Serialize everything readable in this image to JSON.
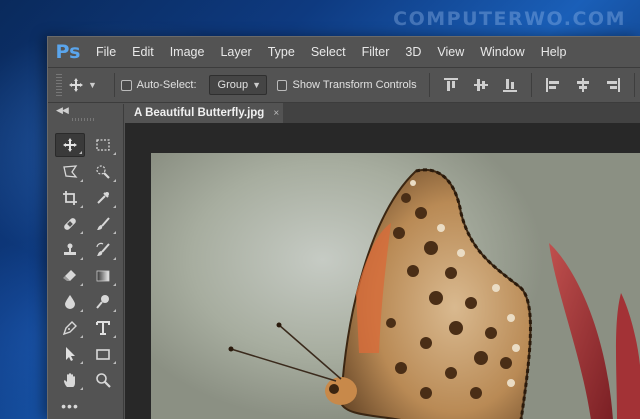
{
  "watermark": "COMPUTERWO.COM",
  "app": {
    "logo": "Ps"
  },
  "menu": [
    "File",
    "Edit",
    "Image",
    "Layer",
    "Type",
    "Select",
    "Filter",
    "3D",
    "View",
    "Window",
    "Help"
  ],
  "options": {
    "auto_select_label": "Auto-Select:",
    "auto_select_value": "Group",
    "show_transform_label": "Show Transform Controls",
    "auto_select_checked": false,
    "show_transform_checked": false
  },
  "tools": [
    "move-tool",
    "marquee-tool",
    "lasso-tool",
    "quick-select-tool",
    "crop-tool",
    "eyedropper-tool",
    "healing-brush-tool",
    "brush-tool",
    "clone-stamp-tool",
    "history-brush-tool",
    "eraser-tool",
    "gradient-tool",
    "blur-tool",
    "dodge-tool",
    "pen-tool",
    "type-tool",
    "path-select-tool",
    "rectangle-tool",
    "hand-tool",
    "zoom-tool",
    "more-tools"
  ],
  "document": {
    "tab_title": "A Beautiful Butterfly.jpg",
    "close_glyph": "×"
  },
  "colors": {
    "ps_blue": "#5aa5ec",
    "panel": "#535353",
    "workspace": "#282828"
  }
}
